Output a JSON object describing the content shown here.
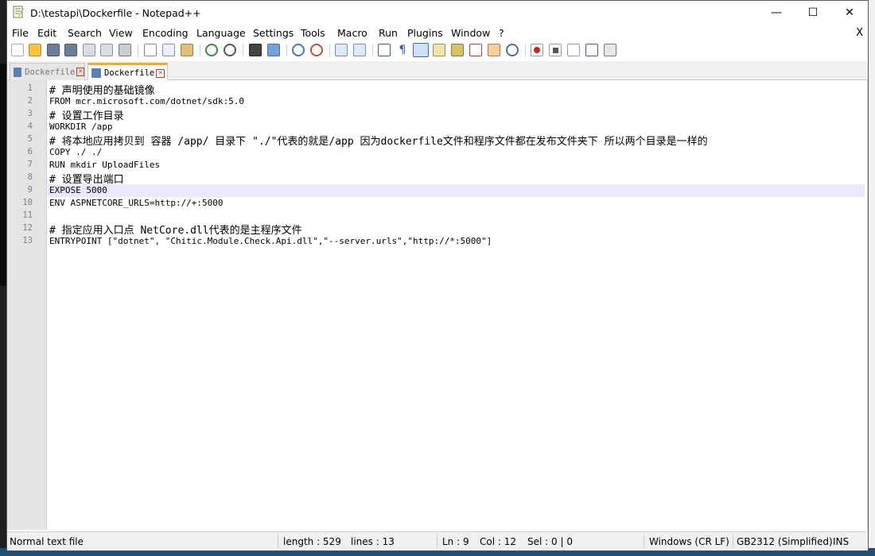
{
  "window": {
    "title": "D:\\testapi\\Dockerfile - Notepad++",
    "minimize": "—",
    "maximize": "☐",
    "close": "✕"
  },
  "menu": {
    "items": [
      "File",
      "Edit",
      "Search",
      "View",
      "Encoding",
      "Language",
      "Settings",
      "Tools",
      "Macro",
      "Run",
      "Plugins",
      "Window",
      "?"
    ],
    "close_doc": "X"
  },
  "tabs": [
    {
      "label": "Dockerfile",
      "active": false
    },
    {
      "label": "Dockerfile",
      "active": true
    }
  ],
  "editor": {
    "current_line": 9,
    "lines": [
      {
        "n": "1",
        "text": "# 声明使用的基础镜像",
        "comment": true
      },
      {
        "n": "2",
        "text": "FROM mcr.microsoft.com/dotnet/sdk:5.0",
        "comment": false
      },
      {
        "n": "3",
        "text": "# 设置工作目录",
        "comment": true
      },
      {
        "n": "4",
        "text": "WORKDIR /app",
        "comment": false
      },
      {
        "n": "5",
        "text": "# 将本地应用拷贝到 容器 /app/ 目录下 \"./\"代表的就是/app 因为dockerfile文件和程序文件都在发布文件夹下 所以两个目录是一样的",
        "comment": true
      },
      {
        "n": "6",
        "text": "COPY ./ ./",
        "comment": false
      },
      {
        "n": "7",
        "text": "RUN mkdir UploadFiles",
        "comment": false
      },
      {
        "n": "8",
        "text": "# 设置导出端口",
        "comment": true
      },
      {
        "n": "9",
        "text": "EXPOSE 5000",
        "comment": false
      },
      {
        "n": "10",
        "text": "ENV ASPNETCORE_URLS=http://+:5000",
        "comment": false
      },
      {
        "n": "11",
        "text": "",
        "comment": false
      },
      {
        "n": "12",
        "text": "# 指定应用入口点 NetCore.dll代表的是主程序文件",
        "comment": true
      },
      {
        "n": "13",
        "text": "ENTRYPOINT [\"dotnet\", \"Chitic.Module.Check.Api.dll\",\"--server.urls\",\"http://*:5000\"]",
        "comment": false
      }
    ]
  },
  "status": {
    "file_type": "Normal text file",
    "length": "length : 529",
    "lines": "lines : 13",
    "ln": "Ln : 9",
    "col": "Col : 12",
    "sel": "Sel : 0 | 0",
    "eol": "Windows (CR LF)",
    "encoding": "GB2312 (Simplified)",
    "mode": "INS"
  },
  "colors": {
    "accent_tab": "#f9a43a",
    "current_line": "#e8e8ff",
    "gutter": "#e4e4e4"
  }
}
